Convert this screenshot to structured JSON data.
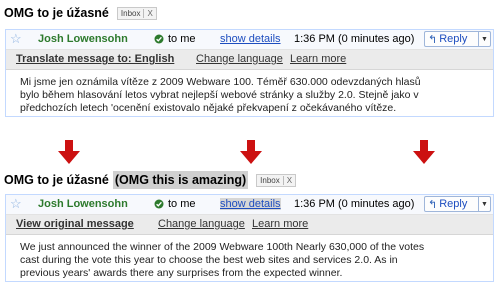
{
  "top": {
    "subject": "OMG to je úžasné",
    "label_chip": "Inbox",
    "chip_close": "X",
    "sender": "Josh Lowensohn",
    "to": "to me",
    "show_details": "show details",
    "time": "1:36 PM (0 minutes ago)",
    "reply": "Reply",
    "bar_primary": "Translate message to: English",
    "bar_change": "Change language",
    "bar_learn": "Learn more",
    "body_lines": [
      "Mi jsme jen oznámila vítěze z 2009 Webware 100. Téměř 630.000 odevzdaných hlasů",
      "bylo během hlasování letos vybrat nejlepší webové stránky a služby 2.0. Stejně jako v",
      "předchozích letech 'ocenění existovalo nějaké překvapení z očekávaného vítěze."
    ]
  },
  "bottom": {
    "subject": "OMG to je úžasné",
    "subject_translation": "(OMG this is amazing)",
    "label_chip": "Inbox",
    "chip_close": "X",
    "sender": "Josh Lowensohn",
    "to": "to me",
    "show_details": "show details",
    "time": "1:36 PM (0 minutes ago)",
    "reply": "Reply",
    "bar_primary": "View original message",
    "bar_change": "Change language",
    "bar_learn": "Learn more",
    "body_lines": [
      "We just announced the winner of the 2009 Webware 100th Nearly 630,000 of the votes",
      "cast during the vote this year to choose the best web sites and services 2.0. As in",
      "previous years' awards there any surprises from the expected winner."
    ]
  },
  "colors": {
    "arrow": "#cc1111",
    "sender": "#2d7a2d",
    "link": "#1d4dbf"
  }
}
